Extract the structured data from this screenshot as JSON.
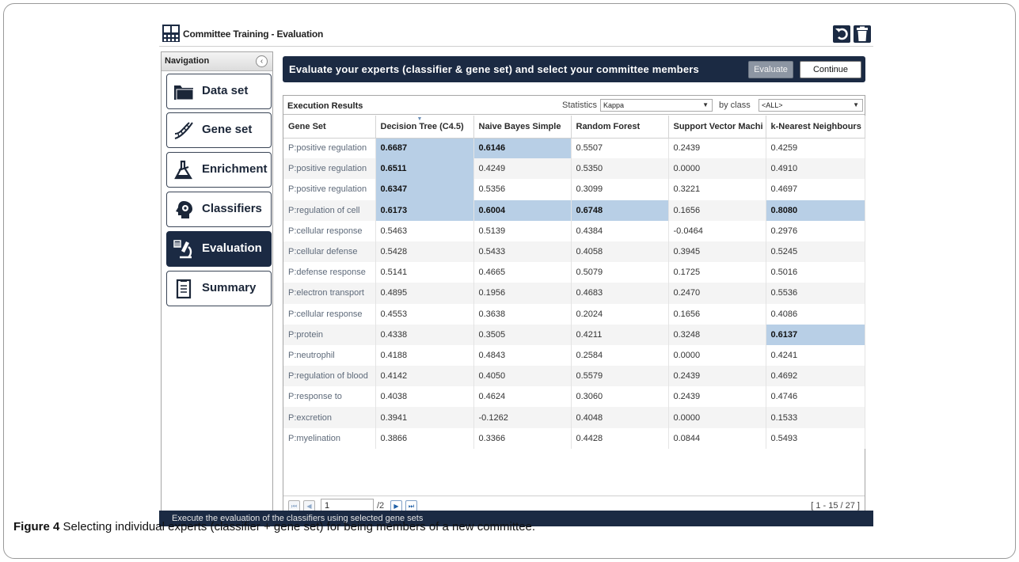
{
  "app": {
    "title": "Committee Training - Evaluation",
    "app_icon": "grid-app-icon",
    "undo_icon": "undo-icon",
    "trash_icon": "trash-icon"
  },
  "navigation": {
    "header": "Navigation",
    "collapse_glyph": "‹",
    "items": [
      {
        "label": "Data set",
        "icon": "folder-icon",
        "active": false
      },
      {
        "label": "Gene set",
        "icon": "dna-icon",
        "active": false
      },
      {
        "label": "Enrichment",
        "icon": "flask-icon",
        "active": false
      },
      {
        "label": "Classifiers",
        "icon": "brain-gear-icon",
        "active": false
      },
      {
        "label": "Evaluation",
        "icon": "microscope-icon",
        "active": true
      },
      {
        "label": "Summary",
        "icon": "clipboard-icon",
        "active": false
      }
    ]
  },
  "header": {
    "text": "Evaluate your experts (classifier & gene set) and select your committee members",
    "evaluate_label": "Evaluate",
    "continue_label": "Continue"
  },
  "results": {
    "title": "Execution Results",
    "statistics_label": "Statistics",
    "statistics_value": "Kappa",
    "byclass_label": "by class",
    "class_value": "<ALL>",
    "dropdown_glyph": "▼",
    "sort_glyph": "▼",
    "columns": [
      "Gene Set",
      "Decision Tree (C4.5)",
      "Naive Bayes Simple",
      "Random Forest",
      "Support Vector Machi",
      "k-Nearest Neighbours"
    ],
    "rows": [
      {
        "cells": [
          "P:positive regulation",
          "0.6687",
          "0.6146",
          "0.5507",
          "0.2439",
          "0.4259"
        ],
        "highlight": [
          1,
          2
        ]
      },
      {
        "cells": [
          "P:positive regulation",
          "0.6511",
          "0.4249",
          "0.5350",
          "0.0000",
          "0.4910"
        ],
        "highlight": [
          1
        ]
      },
      {
        "cells": [
          "P:positive regulation",
          "0.6347",
          "0.5356",
          "0.3099",
          "0.3221",
          "0.4697"
        ],
        "highlight": [
          1
        ]
      },
      {
        "cells": [
          "P:regulation of cell",
          "0.6173",
          "0.6004",
          "0.6748",
          "0.1656",
          "0.8080"
        ],
        "highlight": [
          1,
          2,
          3,
          5
        ]
      },
      {
        "cells": [
          "P:cellular response",
          "0.5463",
          "0.5139",
          "0.4384",
          "-0.0464",
          "0.2976"
        ],
        "highlight": []
      },
      {
        "cells": [
          "P:cellular defense",
          "0.5428",
          "0.5433",
          "0.4058",
          "0.3945",
          "0.5245"
        ],
        "highlight": []
      },
      {
        "cells": [
          "P:defense response",
          "0.5141",
          "0.4665",
          "0.5079",
          "0.1725",
          "0.5016"
        ],
        "highlight": []
      },
      {
        "cells": [
          "P:electron transport",
          "0.4895",
          "0.1956",
          "0.4683",
          "0.2470",
          "0.5536"
        ],
        "highlight": []
      },
      {
        "cells": [
          "P:cellular response",
          "0.4553",
          "0.3638",
          "0.2024",
          "0.1656",
          "0.4086"
        ],
        "highlight": []
      },
      {
        "cells": [
          "P:protein",
          "0.4338",
          "0.3505",
          "0.4211",
          "0.3248",
          "0.6137"
        ],
        "highlight": [
          5
        ]
      },
      {
        "cells": [
          "P:neutrophil",
          "0.4188",
          "0.4843",
          "0.2584",
          "0.0000",
          "0.4241"
        ],
        "highlight": []
      },
      {
        "cells": [
          "P:regulation of blood",
          "0.4142",
          "0.4050",
          "0.5579",
          "0.2439",
          "0.4692"
        ],
        "highlight": []
      },
      {
        "cells": [
          "P:response to",
          "0.4038",
          "0.4624",
          "0.3060",
          "0.2439",
          "0.4746"
        ],
        "highlight": []
      },
      {
        "cells": [
          "P:excretion",
          "0.3941",
          "-0.1262",
          "0.4048",
          "0.0000",
          "0.1533"
        ],
        "highlight": []
      },
      {
        "cells": [
          "P:myelination",
          "0.3866",
          "0.3366",
          "0.4428",
          "0.0844",
          "0.5493"
        ],
        "highlight": []
      }
    ]
  },
  "pager": {
    "first_glyph": "⏮",
    "prev_glyph": "◀",
    "next_glyph": "▶",
    "last_glyph": "⏭",
    "current_page": "1",
    "total_pages": "/2",
    "range": "[ 1 - 15 / 27 ]"
  },
  "status": {
    "text": "Execute the evaluation of the classifiers using selected gene sets"
  },
  "caption": {
    "label": "Figure 4",
    "text": " Selecting individual experts (classifier + gene set) for being members of a new committee."
  }
}
